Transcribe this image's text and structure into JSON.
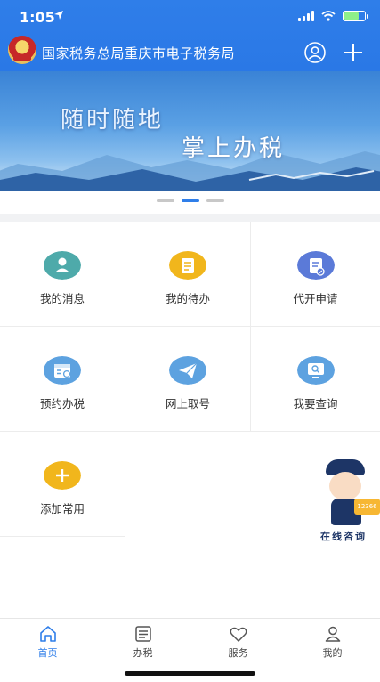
{
  "status_bar": {
    "time": "1:05"
  },
  "header": {
    "title": "国家税务总局重庆市电子税务局"
  },
  "banner": {
    "line1": "随时随地",
    "line2": "掌上办税",
    "dot_count": 3,
    "active_dot": 1
  },
  "grid": [
    {
      "label": "我的消息",
      "icon": "person-icon",
      "color": "#4eaaaa"
    },
    {
      "label": "我的待办",
      "icon": "document-icon",
      "color": "#f1b61c"
    },
    {
      "label": "代开申请",
      "icon": "document-check-icon",
      "color": "#5b7ad8"
    },
    {
      "label": "预约办税",
      "icon": "calendar-icon",
      "color": "#5da2e0"
    },
    {
      "label": "网上取号",
      "icon": "paper-plane-icon",
      "color": "#5da2e0"
    },
    {
      "label": "我要查询",
      "icon": "monitor-search-icon",
      "color": "#5da2e0"
    },
    {
      "label": "添加常用",
      "icon": "plus-icon",
      "color": "#f1b61c"
    }
  ],
  "assistant": {
    "caption": "在线咨询",
    "badge": "12366"
  },
  "tabbar": [
    {
      "label": "首页",
      "icon": "home-icon",
      "active": true
    },
    {
      "label": "办税",
      "icon": "list-icon",
      "active": false
    },
    {
      "label": "服务",
      "icon": "heart-icon",
      "active": false
    },
    {
      "label": "我的",
      "icon": "person-icon",
      "active": false
    }
  ],
  "colors": {
    "primary": "#2f7ee9",
    "separator": "#f1f2f4"
  }
}
